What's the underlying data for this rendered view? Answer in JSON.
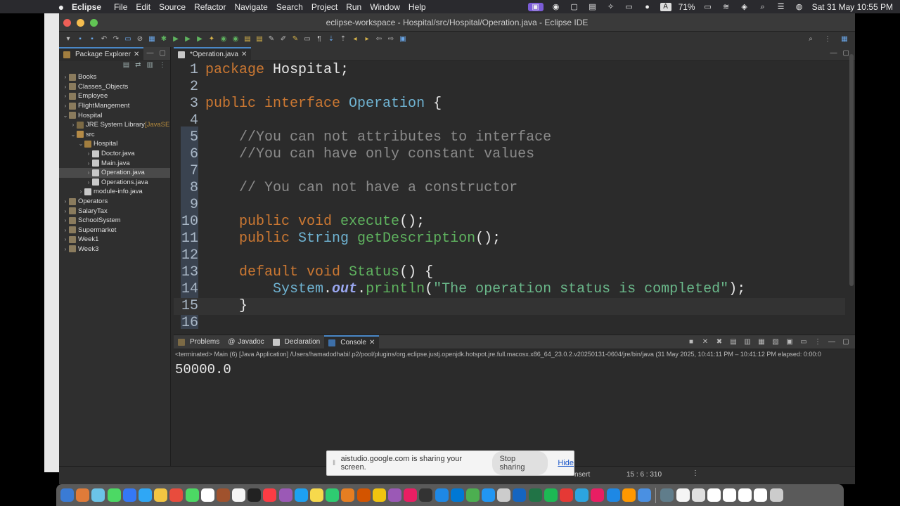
{
  "menubar": {
    "apple": "",
    "items": [
      "Eclipse",
      "File",
      "Edit",
      "Source",
      "Refactor",
      "Navigate",
      "Search",
      "Project",
      "Run",
      "Window",
      "Help"
    ],
    "battery": "71%",
    "datetime": "Sat 31 May  10:55 PM",
    "input_badge": "A"
  },
  "window": {
    "title": "eclipse-workspace - Hospital/src/Hospital/Operation.java - Eclipse IDE"
  },
  "explorer": {
    "tab_label": "Package Explorer",
    "tree": [
      {
        "label": "Books",
        "depth": 0,
        "arrow": "›",
        "icon": "proj"
      },
      {
        "label": "Classes_Objects",
        "depth": 0,
        "arrow": "›",
        "icon": "proj"
      },
      {
        "label": "Employee",
        "depth": 0,
        "arrow": "›",
        "icon": "proj"
      },
      {
        "label": "FlightMangement",
        "depth": 0,
        "arrow": "›",
        "icon": "proj"
      },
      {
        "label": "Hospital",
        "depth": 0,
        "arrow": "⌄",
        "icon": "proj"
      },
      {
        "label": "JRE System Library",
        "suffix": "[JavaSE",
        "depth": 1,
        "arrow": "›",
        "icon": "lib"
      },
      {
        "label": "src",
        "depth": 1,
        "arrow": "⌄",
        "icon": "src"
      },
      {
        "label": "Hospital",
        "depth": 2,
        "arrow": "⌄",
        "icon": "pkg"
      },
      {
        "label": "Doctor.java",
        "depth": 3,
        "arrow": "›",
        "icon": "jfile"
      },
      {
        "label": "Main.java",
        "depth": 3,
        "arrow": "›",
        "icon": "jfile"
      },
      {
        "label": "Operation.java",
        "depth": 3,
        "arrow": "›",
        "icon": "jfile",
        "selected": true
      },
      {
        "label": "Operations.java",
        "depth": 3,
        "arrow": "›",
        "icon": "jfile"
      },
      {
        "label": "module-info.java",
        "depth": 2,
        "arrow": "›",
        "icon": "jfile"
      },
      {
        "label": "Operators",
        "depth": 0,
        "arrow": "›",
        "icon": "proj"
      },
      {
        "label": "SalaryTax",
        "depth": 0,
        "arrow": "›",
        "icon": "proj"
      },
      {
        "label": "SchoolSystem",
        "depth": 0,
        "arrow": "›",
        "icon": "proj"
      },
      {
        "label": "Supermarket",
        "depth": 0,
        "arrow": "›",
        "icon": "proj"
      },
      {
        "label": "Week1",
        "depth": 0,
        "arrow": "›",
        "icon": "proj"
      },
      {
        "label": "Week3",
        "depth": 0,
        "arrow": "›",
        "icon": "proj"
      }
    ]
  },
  "editor": {
    "tab_label": "*Operation.java",
    "lines": [
      {
        "n": "1",
        "tokens": [
          [
            "kw",
            "package "
          ],
          [
            "",
            "Hospital;"
          ]
        ]
      },
      {
        "n": "2",
        "tokens": []
      },
      {
        "n": "3",
        "tokens": [
          [
            "kw",
            "public interface "
          ],
          [
            "cls",
            "Operation "
          ],
          [
            "",
            "{"
          ]
        ]
      },
      {
        "n": "4",
        "tokens": []
      },
      {
        "n": "5",
        "tokens": [
          [
            "",
            "    "
          ],
          [
            "cm",
            "//You can not attributes to interface"
          ]
        ]
      },
      {
        "n": "6",
        "tokens": [
          [
            "",
            "    "
          ],
          [
            "cm",
            "//You can have only constant values"
          ]
        ]
      },
      {
        "n": "7",
        "tokens": []
      },
      {
        "n": "8",
        "tokens": [
          [
            "",
            "    "
          ],
          [
            "cm",
            "// You can not have a constructor"
          ]
        ]
      },
      {
        "n": "9",
        "tokens": []
      },
      {
        "n": "10",
        "tokens": [
          [
            "",
            "    "
          ],
          [
            "kw",
            "public void "
          ],
          [
            "fn",
            "execute"
          ],
          [
            "",
            "();"
          ]
        ]
      },
      {
        "n": "11",
        "tokens": [
          [
            "",
            "    "
          ],
          [
            "kw",
            "public "
          ],
          [
            "ty",
            "String "
          ],
          [
            "fn",
            "getDescription"
          ],
          [
            "",
            "();"
          ]
        ]
      },
      {
        "n": "12",
        "tokens": []
      },
      {
        "n": "13",
        "tokens": [
          [
            "",
            "    "
          ],
          [
            "kw",
            "default void "
          ],
          [
            "fn",
            "Status"
          ],
          [
            "",
            "() {"
          ]
        ]
      },
      {
        "n": "14",
        "tokens": [
          [
            "",
            "        "
          ],
          [
            "cls",
            "System"
          ],
          [
            "",
            "."
          ],
          [
            "fld",
            "out"
          ],
          [
            "",
            "."
          ],
          [
            "fn",
            "println"
          ],
          [
            "",
            "("
          ],
          [
            "st",
            "\"The operation status is completed\""
          ],
          [
            "",
            ");"
          ]
        ]
      },
      {
        "n": "15",
        "tokens": [
          [
            "",
            "    }"
          ]
        ],
        "current": true
      },
      {
        "n": "16",
        "tokens": []
      }
    ]
  },
  "console": {
    "tabs": [
      "Problems",
      "Javadoc",
      "Declaration",
      "Console"
    ],
    "active_tab": "Console",
    "info": "<terminated> Main (6) [Java Application] /Users/hamadodhabi/.p2/pool/plugins/org.eclipse.justj.openjdk.hotspot.jre.full.macosx.x86_64_23.0.2.v20250131-0604/jre/bin/java  (31 May 2025, 10:41:11 PM – 10:41:12 PM elapsed: 0:00:0",
    "output": "50000.0"
  },
  "statusbar": {
    "mode": "nsert",
    "position": "15 : 6 : 310",
    "dots": "⋮"
  },
  "share_banner": {
    "text": "aistudio.google.com is sharing your screen.",
    "stop_label": "Stop sharing",
    "hide_label": "Hide"
  },
  "dock": {
    "icon_colors": [
      "#3a7bd5",
      "#e07b39",
      "#6bc4e8",
      "#4cd964",
      "#3478f6",
      "#2fa7f5",
      "#f4c542",
      "#e84c3d",
      "#4cd964",
      "#ffffff",
      "#a0522d",
      "#f5f5f5",
      "#222222",
      "#fc3c44",
      "#9b59b6",
      "#1da1f2",
      "#f7d94c",
      "#2ecc71",
      "#e67e22",
      "#d35400",
      "#f1c40f",
      "#9b59b6",
      "#e91e63",
      "#333333",
      "#1e88e5",
      "#0078d4",
      "#4caf50",
      "#2196f3",
      "#cccccc",
      "#1565c0",
      "#217346",
      "#1db954",
      "#e53935",
      "#2ca5e0",
      "#e91e63",
      "#1e88e5",
      "#ff9800",
      "#4a90e2",
      "#607d8b",
      "#f5f5f5",
      "#e0e0e0",
      "#ffffff",
      "#ffffff",
      "#ffffff",
      "#ffffff",
      "#cccccc"
    ]
  }
}
